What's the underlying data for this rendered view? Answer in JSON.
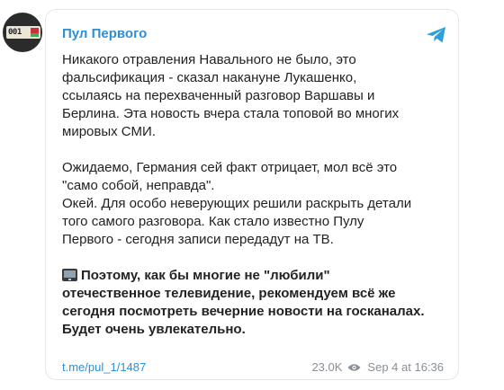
{
  "avatar": {
    "plate_text": "001",
    "flag_colors": [
      "#c8313e",
      "#4aa657"
    ]
  },
  "post": {
    "channel_name": "Пул Первого",
    "paragraphs": [
      {
        "lines": [
          "Никакого отравления Навального не было, это",
          "фальсификация - сказал накануне Лукашенко,",
          "ссылаясь на перехваченный разговор Варшавы и",
          "Берлина. Эта новость вчера стала топовой во многих",
          "мировых СМИ."
        ]
      },
      {
        "lines": [
          "Ожидаемо, Германия сей факт отрицает, мол всё это",
          "\"само собой, неправда\".",
          "Окей. Для особо неверующих решили раскрыть детали",
          "того самого разговора. Как стало известно Пулу",
          "Первого - сегодня записи передадут на ТВ."
        ]
      },
      {
        "lines": [
          "Поэтому, как бы многие не \"любили\"",
          "отечественное телевидение, рекомендуем всё же",
          "сегодня посмотреть вечерние новости на госканалах.",
          "Будет очень увлекательно."
        ]
      }
    ],
    "link": "t.me/pul_1/1487",
    "views": "23.0K",
    "date": "Sep 4 at 16:36"
  },
  "icons": {
    "telegram": "telegram-logo-icon",
    "eye": "eye-icon",
    "tv": "television-icon"
  },
  "colors": {
    "accent": "#2e8fd6",
    "text": "#222222",
    "meta": "#8a8f95",
    "border": "#e4e6ea"
  }
}
